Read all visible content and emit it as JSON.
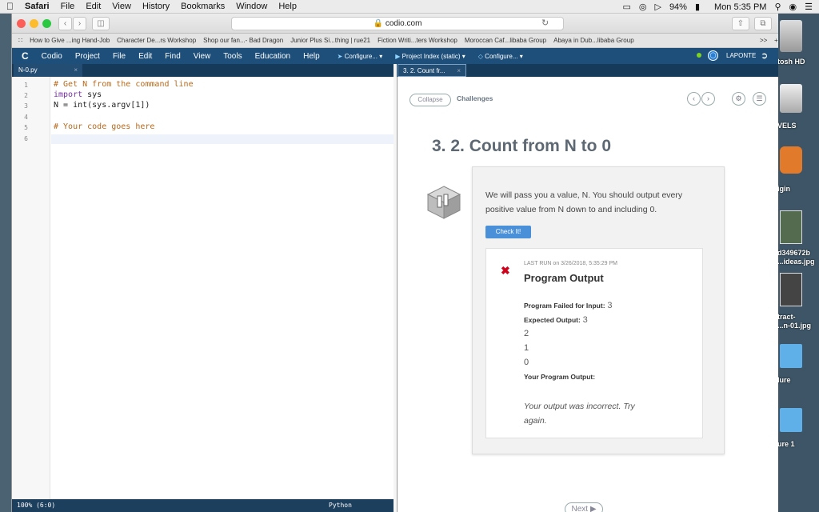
{
  "menubar": {
    "items": [
      "Safari",
      "File",
      "Edit",
      "View",
      "History",
      "Bookmarks",
      "Window",
      "Help"
    ],
    "battery": "94%",
    "clock": "Mon 5:35 PM"
  },
  "browser": {
    "url": "codio.com",
    "bookmarks": [
      "How to Give ...ing Hand-Job",
      "Character De...rs Workshop",
      "Shop our fan...- Bad Dragon",
      "Junior Plus Si...thing | rue21",
      "Fiction Writi...ters Workshop",
      "Moroccan Caf...libaba Group",
      "Abaya in Dub...libaba Group"
    ],
    "bookmarks_more": ">>"
  },
  "codio": {
    "menu": [
      "Codio",
      "Project",
      "File",
      "Edit",
      "Find",
      "View",
      "Tools",
      "Education",
      "Help"
    ],
    "configure1": "Configure...",
    "project_index": "Project Index (static)",
    "configure2": "Configure...",
    "user": "LAPONTE"
  },
  "editor": {
    "tab": "N-0.py",
    "lines": [
      {
        "n": "1",
        "text": "# Get N from the command line",
        "type": "comment"
      },
      {
        "n": "2",
        "kw": "import",
        "text": " sys",
        "type": "import"
      },
      {
        "n": "3",
        "text": "N = int(sys.argv[1])",
        "type": "code"
      },
      {
        "n": "4",
        "text": "",
        "type": "blank"
      },
      {
        "n": "5",
        "text": "# Your code goes here",
        "type": "comment"
      },
      {
        "n": "6",
        "text": "",
        "type": "blank"
      }
    ],
    "status_left": "100% (6:0)",
    "status_mode": "Python"
  },
  "guide": {
    "tab": "3. 2. Count fr...",
    "collapse": "Collapse",
    "challenges": "Challenges",
    "title": "3. 2. Count from N to 0",
    "description": "We will pass you a value, N. You should output every positive value from N down to and including 0.",
    "check_button": "Check It!",
    "last_run": "LAST RUN on 3/26/2018, 5:35:29 PM",
    "result_title": "Program Output",
    "failed_label": "Program Failed for Input:",
    "failed_value": "3",
    "expected_label": "Expected Output:",
    "expected_values": [
      "3",
      "2",
      "1",
      "0"
    ],
    "your_output_label": "Your Program Output:",
    "message": "Your output was incorrect. Try again.",
    "next": "Next"
  },
  "desktop": {
    "labels": [
      "tosh HD",
      "VELS",
      "igin",
      "d349672b",
      "...ideas.jpg",
      "tract-",
      "...n-01.jpg",
      "lure",
      "ure 1"
    ]
  },
  "colors": {
    "codio_blue": "#1d4f7a",
    "comment": "#b8691b",
    "keyword": "#7b2fa8",
    "check_button": "#4a90d9",
    "error_red": "#d0021b"
  }
}
